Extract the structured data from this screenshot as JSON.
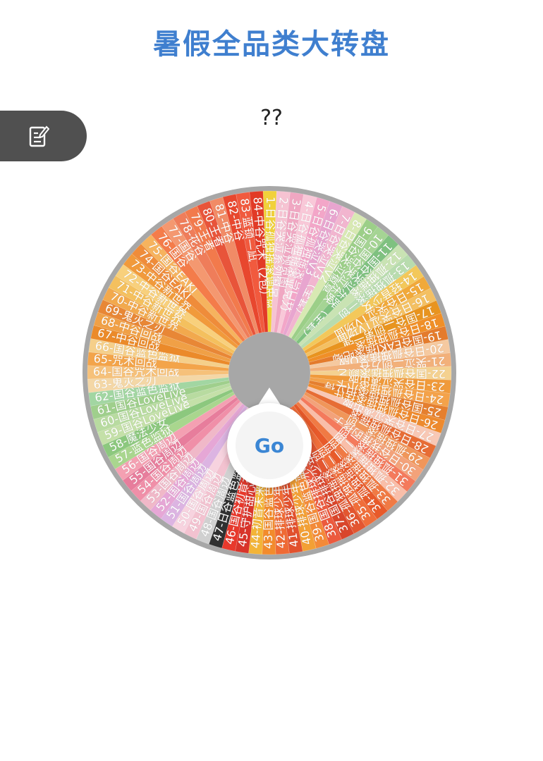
{
  "header": {
    "title": "暑假全品类大转盘"
  },
  "result": {
    "text": "??"
  },
  "side_tab": {
    "icon": "edit-document-icon"
  },
  "go_button": {
    "label": "Go"
  },
  "wheel": {
    "start_deg": -2,
    "prizes": [
      {
        "label": "1-日谷孤独摇滚调色盘",
        "color": "#f1d13a"
      },
      {
        "label": "2-日谷哭泣系列徽章",
        "color": "#f6c3d2"
      },
      {
        "label": "3-日谷哭泣预览图",
        "color": "#f0a7c2"
      },
      {
        "label": "4-日谷孤独摇滚亚克力",
        "color": "#f9c8d8"
      },
      {
        "label": "5-日谷孤独摇滚马口铁",
        "color": "#f3a6c8"
      },
      {
        "label": "6-日谷哭泣V3",
        "color": "#e8a5cf"
      },
      {
        "label": "7-日谷哭泣V3（全套）",
        "color": "#f2b5cf"
      },
      {
        "label": "8-日谷哭泣V2",
        "color": "#d8e9b3"
      },
      {
        "label": "9-国谷哭泣徽章",
        "color": "#9ccf88"
      },
      {
        "label": "10-国谷哭泣东映",
        "color": "#a5d494"
      },
      {
        "label": "11-国谷哭泣东映（全套）",
        "color": "#7fc180"
      },
      {
        "label": "12-孤独摇滚",
        "color": "#c9e3b3"
      },
      {
        "label": "13-孤独摇滚—创",
        "color": "#b8dcae"
      },
      {
        "label": "14-轻音少女",
        "color": "#f3c85a"
      },
      {
        "label": "15-日谷哭泣TV场面",
        "color": "#f1a93a"
      },
      {
        "label": "16-日谷哭泣TV场面",
        "color": "#f4c062"
      },
      {
        "label": "17-国谷二创第一弹",
        "color": "#e8941f"
      },
      {
        "label": "18-日谷孤独摇滚",
        "color": "#f08f27"
      },
      {
        "label": "19-国谷EAKI摇滚吧唧",
        "color": "#e47b2c"
      },
      {
        "label": "20-日谷孤独摇滚Q版",
        "color": "#f5c9a0"
      },
      {
        "label": "21-哭泣二创方谷",
        "color": "#f2b07a"
      },
      {
        "label": "22-国谷孤独摇滚颜艺",
        "color": "#f4d190"
      },
      {
        "label": "23-日谷哭泣演出服",
        "color": "#f09a3b"
      },
      {
        "label": "24-日谷孤独摇滚小卡",
        "color": "#f4a24a"
      },
      {
        "label": "25-国谷孤独摇滚拍立得",
        "color": "#e57f2f"
      },
      {
        "label": "26-日谷孤独摇滚挂件",
        "color": "#ee8a2e"
      },
      {
        "label": "27-日谷哭泣演出服",
        "color": "#f8c8b5"
      },
      {
        "label": "28-日谷孤独摇滚",
        "color": "#e76d35"
      },
      {
        "label": "29-孤独摇滚二创",
        "color": "#f0965a"
      },
      {
        "label": "30-日谷我推的孩子",
        "color": "#f3a27a"
      },
      {
        "label": "31-孤独摇滚二创",
        "color": "#f47a5c"
      },
      {
        "label": "32-孤独摇滚二创",
        "color": "#f9bea9"
      },
      {
        "label": "33-孤独摇滚二创",
        "color": "#f07a44"
      },
      {
        "label": "34-孤独摇滚二创",
        "color": "#e85a2a"
      },
      {
        "label": "35-孤独摇滚二创",
        "color": "#f06e3a"
      },
      {
        "label": "36-孤独摇滚二创",
        "color": "#e35630"
      },
      {
        "label": "37-国谷排球少年",
        "color": "#d9452b"
      },
      {
        "label": "38-国谷排球少年",
        "color": "#ec5a3e"
      },
      {
        "label": "39-国谷蓝色监狱",
        "color": "#f48a38"
      },
      {
        "label": "40-排球少年二创",
        "color": "#f3a035"
      },
      {
        "label": "41-排球少年二创",
        "color": "#e2512d"
      },
      {
        "label": "42-排球少年二创",
        "color": "#ef6a34"
      },
      {
        "label": "43-国谷蓝色监狱",
        "color": "#f28b2c"
      },
      {
        "label": "44-初音未来",
        "color": "#f3b437"
      },
      {
        "label": "45-守护甜心",
        "color": "#d9342a"
      },
      {
        "label": "46-国谷初音未来",
        "color": "#e8392c"
      },
      {
        "label": "47-日谷蓝色监狱",
        "color": "#303030"
      },
      {
        "label": "48-国谷周边",
        "color": "#d0d0d0"
      },
      {
        "label": "49-国谷周边",
        "color": "#f3c2d0"
      },
      {
        "label": "50-国谷周边",
        "color": "#f7d3df"
      },
      {
        "label": "51-国谷周边",
        "color": "#dcb4e2"
      },
      {
        "label": "52-国谷周边",
        "color": "#e6a7d6"
      },
      {
        "label": "53-国谷周边",
        "color": "#f0b8c8"
      },
      {
        "label": "54-国谷周边",
        "color": "#f08fa8"
      },
      {
        "label": "55-国谷周边",
        "color": "#e77d9c"
      },
      {
        "label": "56-国谷周边",
        "color": "#f4a0b2"
      },
      {
        "label": "57-蓝色监狱",
        "color": "#a9d68e"
      },
      {
        "label": "58-魔法少女",
        "color": "#8cc87e"
      },
      {
        "label": "59-国谷LoveLive",
        "color": "#c4e0a8"
      },
      {
        "label": "60-国谷LoveLive",
        "color": "#b8dba0"
      },
      {
        "label": "61-国谷LoveLive",
        "color": "#9fcf8c"
      },
      {
        "label": "62-国谷蓝色监狱",
        "color": "#a2d6a2"
      },
      {
        "label": "63-鬼灭之刃",
        "color": "#f4d7a6"
      },
      {
        "label": "64-国谷咒术回战",
        "color": "#f6c17a"
      },
      {
        "label": "65-咒术回战",
        "color": "#f3a44a"
      },
      {
        "label": "66-国谷蓝色监狱",
        "color": "#f5cf8a"
      },
      {
        "label": "67-中谷回战",
        "color": "#eb8a2a"
      },
      {
        "label": "68-中谷回战",
        "color": "#f0a046"
      },
      {
        "label": "69-鬼灭之刃",
        "color": "#e88736"
      },
      {
        "label": "70-中谷新世界",
        "color": "#f2a94d"
      },
      {
        "label": "71-中谷新世界",
        "color": "#f4c05e"
      },
      {
        "label": "72-中谷新世界",
        "color": "#f8d07c"
      },
      {
        "label": "73-中谷新世界",
        "color": "#f19a3b"
      },
      {
        "label": "74-国谷EAKI",
        "color": "#ef8c3a"
      },
      {
        "label": "75-国谷EAKI",
        "color": "#f6b35e"
      },
      {
        "label": "76-国谷",
        "color": "#f47c4a"
      },
      {
        "label": "77-国谷",
        "color": "#f49870"
      },
      {
        "label": "78-花谷",
        "color": "#ef7d5a"
      },
      {
        "label": "79-王者",
        "color": "#f27a4c"
      },
      {
        "label": "80-王者",
        "color": "#e8543a"
      },
      {
        "label": "81-中谷",
        "color": "#f18b66"
      },
      {
        "label": "82-中谷",
        "color": "#e8472e"
      },
      {
        "label": "83-蓝锁—凪",
        "color": "#f15a3e"
      },
      {
        "label": "84-中谷咒术（2包）",
        "color": "#e23a26"
      }
    ]
  }
}
